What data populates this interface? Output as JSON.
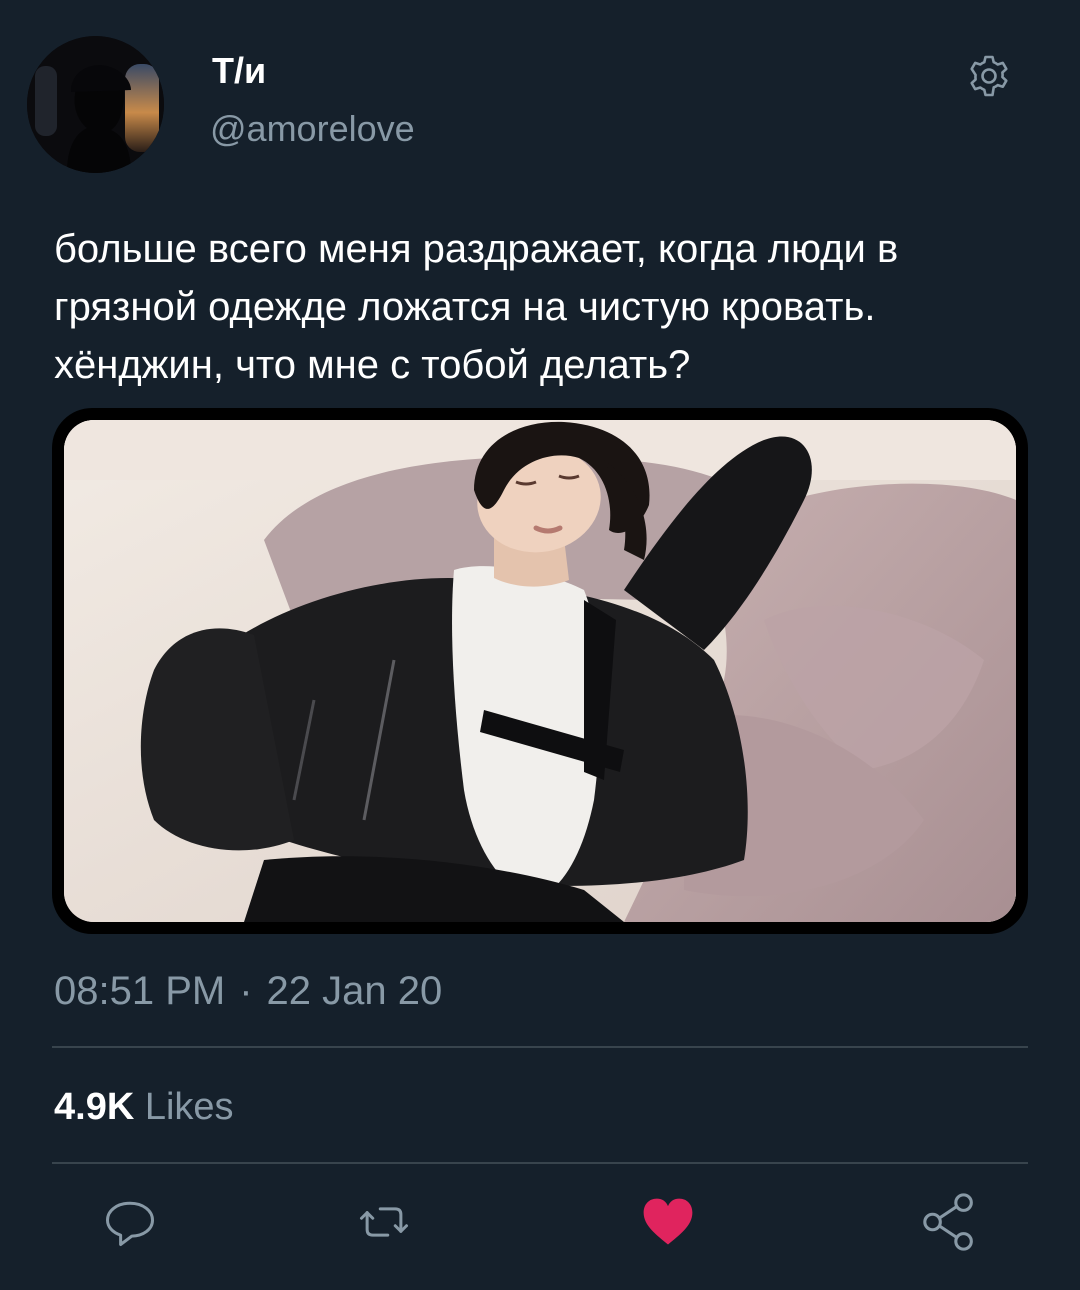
{
  "user": {
    "display_name": "Т/и",
    "handle": "@amorelove",
    "avatar_icon": "avatar-silhouette-window"
  },
  "header": {
    "settings_icon": "gear-icon"
  },
  "tweet": {
    "text": "больше всего меня раздражает, когда люди в грязной одежде ложатся на чистую кровать. хёнджин, что мне с тобой делать?",
    "media_description_icon": "photo-person-sleeping-on-bed",
    "time": "08:51 PM",
    "separator": "·",
    "date": "22 Jan 20"
  },
  "stats": {
    "likes_count": "4.9K",
    "likes_label": "Likes"
  },
  "actions": {
    "reply_icon": "reply-icon",
    "retweet_icon": "retweet-icon",
    "like_icon": "heart-icon",
    "share_icon": "share-icon"
  },
  "colors": {
    "background": "#15202b",
    "secondary_text": "#8899a6",
    "divider": "#38444d",
    "like": "#e0245e"
  }
}
